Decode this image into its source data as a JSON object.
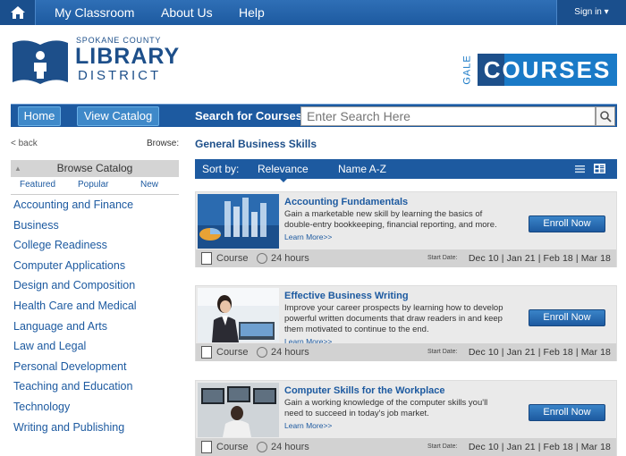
{
  "topnav": {
    "items": [
      "My Classroom",
      "About Us",
      "Help"
    ],
    "signin": "Sign in"
  },
  "logo": {
    "line1": "SPOKANE COUNTY",
    "line2": "LIBRARY",
    "line3": "DISTRICT"
  },
  "gale": {
    "prefix": "GALE",
    "word": "COURSES"
  },
  "catalog_bar": {
    "home": "Home",
    "view_catalog": "View Catalog",
    "search_label": "Search for Courses:",
    "search_placeholder": "Enter Search Here"
  },
  "sidebar": {
    "back": "< back",
    "browse": "Browse:",
    "header": "Browse Catalog",
    "tabs": [
      "Featured",
      "Popular",
      "New"
    ],
    "categories": [
      "Accounting and Finance",
      "Business",
      "College Readiness",
      "Computer Applications",
      "Design and Composition",
      "Health Care and Medical",
      "Language and Arts",
      "Law and Legal",
      "Personal Development",
      "Teaching and Education",
      "Technology",
      "Writing and Publishing"
    ]
  },
  "main": {
    "title": "General Business Skills",
    "sort_label": "Sort by:",
    "sort_options": [
      "Relevance",
      "Name A-Z"
    ]
  },
  "courses": [
    {
      "title": "Accounting Fundamentals",
      "desc": "Gain a marketable new skill by learning the basics of double-entry bookkeeping, financial reporting, and more.",
      "learn": "Learn More>>",
      "enroll": "Enroll Now",
      "type": "Course",
      "hours": "24 hours",
      "start_label": "Start Date:",
      "dates": "Dec 10 | Jan 21 | Feb 18 | Mar 18"
    },
    {
      "title": "Effective Business Writing",
      "desc": "Improve your career prospects by learning how to develop powerful written documents that draw readers in and keep them motivated to continue to the end.",
      "learn": "Learn More>>",
      "enroll": "Enroll Now",
      "type": "Course",
      "hours": "24 hours",
      "start_label": "Start Date:",
      "dates": "Dec 10 | Jan 21 | Feb 18 | Mar 18"
    },
    {
      "title": "Computer Skills for the Workplace",
      "desc": "Gain a working knowledge of the computer skills you'll need to succeed in today's job market.",
      "learn": "Learn More>>",
      "enroll": "Enroll Now",
      "type": "Course",
      "hours": "24 hours",
      "start_label": "Start Date:",
      "dates": "Dec 10 | Jan 21 | Feb 18 | Mar 18"
    }
  ]
}
